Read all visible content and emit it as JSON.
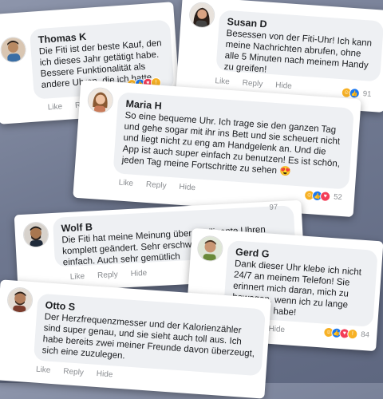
{
  "colors": {
    "like": "#1877f2",
    "love": "#f33e58",
    "haha": "#f7b125",
    "bubble": "#eef0f3",
    "meta": "#8a8d91"
  },
  "actions": {
    "like": "Like",
    "reply": "Reply",
    "hide": "Hide"
  },
  "comments": [
    {
      "name": "Thomas K",
      "text": "Die Fiti ist der beste Kauf, den ich dieses Jahr getätigt habe. Bessere Funktionalität als andere Uhren, die ich hatte.",
      "reactions": [
        "haha-icon",
        "like-icon",
        "love-icon",
        "wow-icon"
      ],
      "count": ""
    },
    {
      "name": "Susan D",
      "text": "Besessen von der Fiti-Uhr! Ich kann meine Nachrichten abrufen, ohne alle 5 Minuten nach meinem Handy zu greifen!",
      "reactions": [
        "haha-icon",
        "like-icon"
      ],
      "count": "91"
    },
    {
      "name": "Maria H",
      "text": "So eine bequeme Uhr. Ich trage sie den ganzen Tag und gehe sogar mit ihr ins Bett und sie scheuert nicht und liegt nicht zu eng am Handgelenk an. Und die App ist auch super einfach zu benutzen! Es ist schön, jeden Tag meine Fortschritte zu sehen 😍",
      "reactions": [
        "haha-icon",
        "like-icon",
        "love-icon"
      ],
      "count": "52"
    },
    {
      "name": "Wolf B",
      "text": "Die Fiti hat meine Meinung über intelligente Uhren komplett geändert. Sehr erschwinglich und sehr einfach. Auch sehr gemütlich",
      "reactions": [],
      "count": "97"
    },
    {
      "name": "Gerd G",
      "text": "Dank dieser Uhr klebe ich nicht 24/7 an meinem Telefon! Sie erinnert mich daran, mich zu bewegen, wenn ich zu lange gesessen habe!",
      "reactions": [
        "haha-icon",
        "like-icon",
        "love-icon",
        "wow-icon"
      ],
      "count": "84"
    },
    {
      "name": "Otto S",
      "text": "Der Herzfrequenzmesser und der Kalorienzähler sind super genau, und sie sieht auch toll aus. Ich habe bereits zwei meiner Freunde davon überzeugt, sich eine zuzulegen.",
      "reactions": [],
      "count": ""
    }
  ]
}
